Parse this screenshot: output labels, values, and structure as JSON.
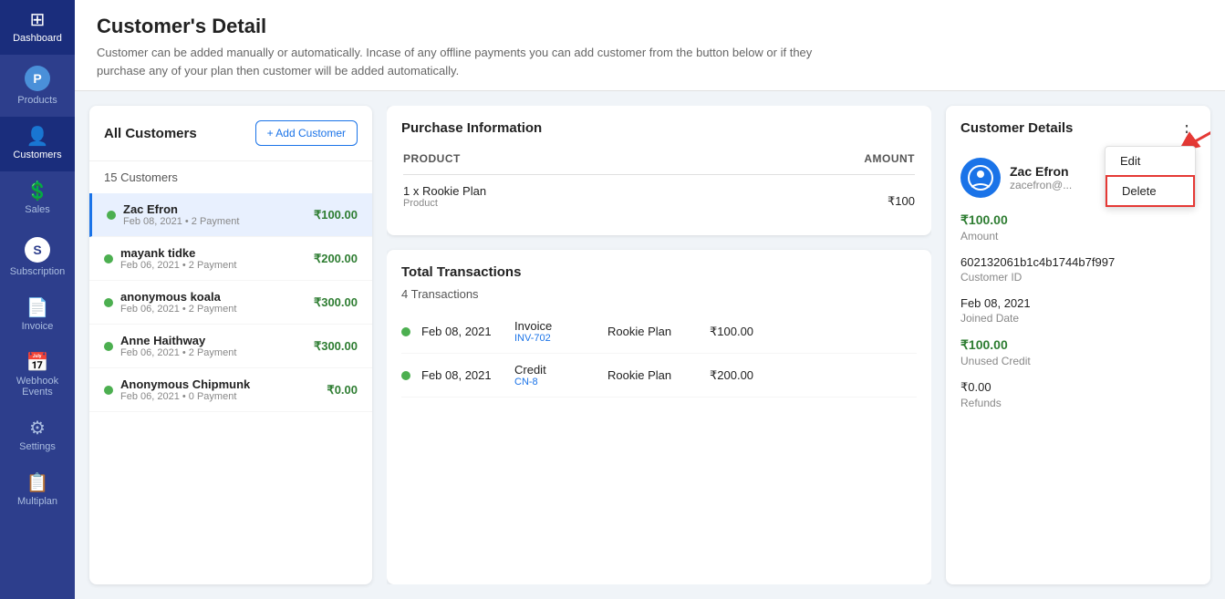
{
  "sidebar": {
    "items": [
      {
        "id": "dashboard",
        "label": "Dashboard",
        "icon": "⊞",
        "active": false
      },
      {
        "id": "products",
        "label": "Products",
        "icon": "P",
        "active": false
      },
      {
        "id": "customers",
        "label": "Customers",
        "icon": "👤",
        "active": true
      },
      {
        "id": "sales",
        "label": "Sales",
        "icon": "↑$",
        "active": false
      },
      {
        "id": "subscription",
        "label": "Subscription",
        "icon": "S",
        "active": false
      },
      {
        "id": "invoice",
        "label": "Invoice",
        "icon": "📄",
        "active": false
      },
      {
        "id": "webhook",
        "label": "Webhook Events",
        "icon": "📅",
        "active": false
      },
      {
        "id": "settings",
        "label": "Settings",
        "icon": "⚙",
        "active": false
      },
      {
        "id": "multiplan",
        "label": "Multiplan",
        "icon": "📋",
        "active": false
      }
    ]
  },
  "header": {
    "title": "Customer's Detail",
    "description": "Customer can be added manually or automatically. Incase of any offline payments you can add customer from the button below or if they purchase any of your plan then customer will be added automatically."
  },
  "customers_panel": {
    "title": "All Customers",
    "add_button": "+ Add Customer",
    "count": "15 Customers",
    "customers": [
      {
        "name": "Zac Efron",
        "date": "Feb 08, 2021",
        "payments": "2 Payment",
        "amount": "₹100.00",
        "active": true,
        "selected": true
      },
      {
        "name": "mayank tidke",
        "date": "Feb 06, 2021",
        "payments": "2 Payment",
        "amount": "₹200.00",
        "active": true,
        "selected": false
      },
      {
        "name": "anonymous koala",
        "date": "Feb 06, 2021",
        "payments": "2 Payment",
        "amount": "₹300.00",
        "active": true,
        "selected": false
      },
      {
        "name": "Anne Haithway",
        "date": "Feb 06, 2021",
        "payments": "2 Payment",
        "amount": "₹300.00",
        "active": true,
        "selected": false
      },
      {
        "name": "Anonymous Chipmunk",
        "date": "Feb 06, 2021",
        "payments": "0 Payment",
        "amount": "₹0.00",
        "active": true,
        "selected": false
      }
    ]
  },
  "purchase_panel": {
    "title": "Purchase Information",
    "col_product": "PRODUCT",
    "col_amount": "AMOUNT",
    "product_name": "1 x Rookie Plan",
    "product_type": "Product",
    "product_amount": "₹100"
  },
  "transactions_panel": {
    "title": "Total Transactions",
    "count": "4 Transactions",
    "transactions": [
      {
        "date": "Feb 08, 2021",
        "type": "Invoice",
        "id": "INV-702",
        "plan": "Rookie Plan",
        "amount": "₹100.00",
        "active": true
      },
      {
        "date": "Feb 08, 2021",
        "type": "Credit",
        "id": "CN-8",
        "plan": "Rookie Plan",
        "amount": "₹200.00",
        "active": true
      }
    ]
  },
  "customer_details": {
    "title": "Customer Details",
    "name": "Zac Efron",
    "email": "zacefron@...",
    "amount": "₹100.00",
    "amount_label": "Amount",
    "customer_id": "602132061b1c4b1744b7f997",
    "customer_id_label": "Customer ID",
    "joined_date": "Feb 08, 2021",
    "joined_date_label": "Joined Date",
    "unused_credit": "₹100.00",
    "unused_credit_label": "Unused Credit",
    "refunds": "₹0.00",
    "refunds_label": "Refunds",
    "dropdown": {
      "edit": "Edit",
      "delete": "Delete"
    }
  }
}
